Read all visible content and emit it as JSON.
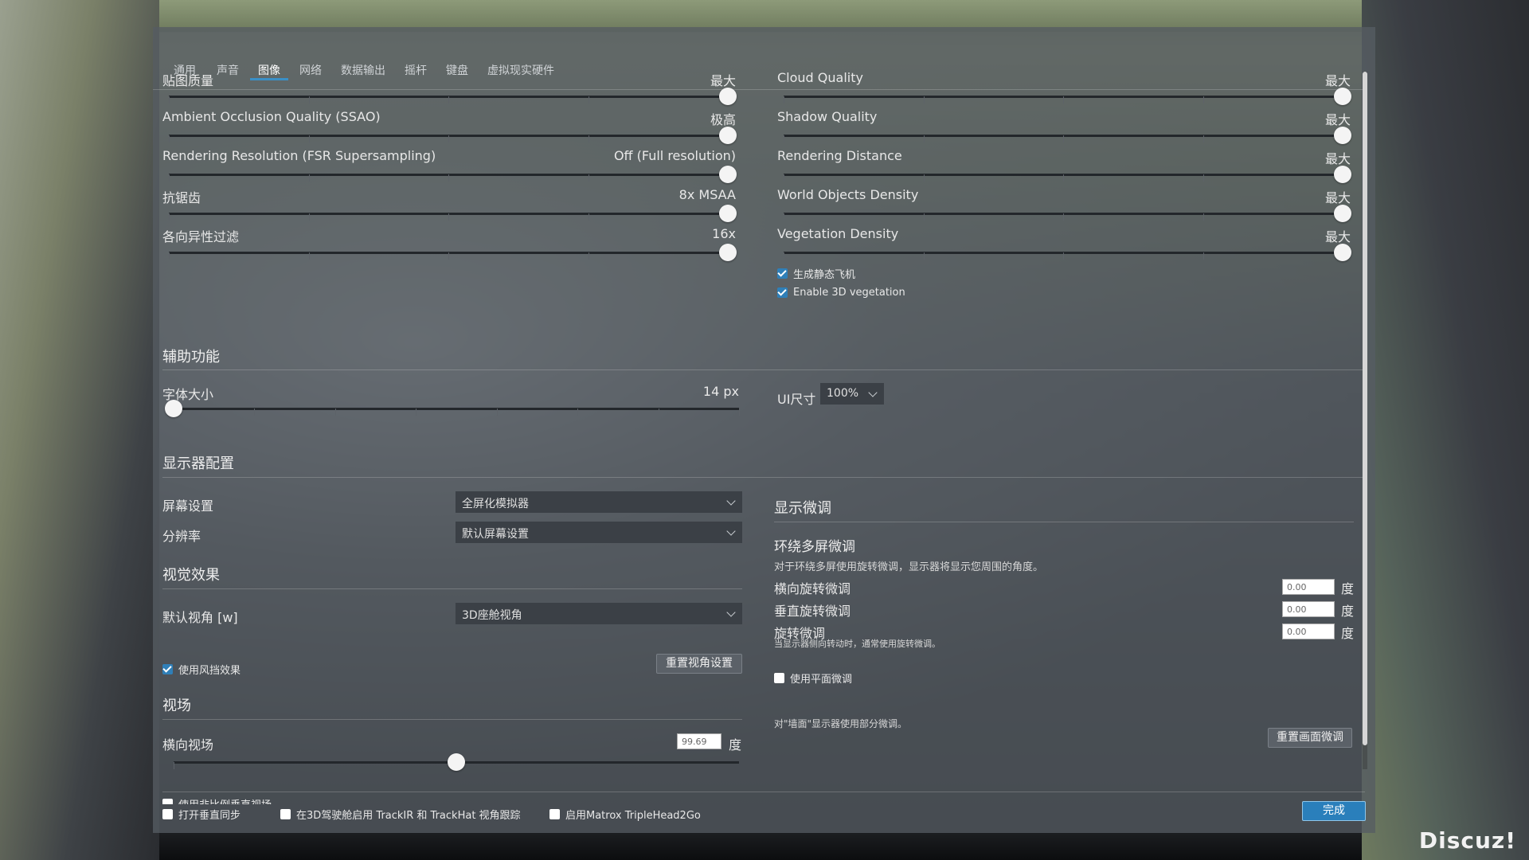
{
  "tabs": [
    "通用",
    "声音",
    "图像",
    "网络",
    "数据输出",
    "摇杆",
    "键盘",
    "虚拟现实硬件"
  ],
  "active_tab": "图像",
  "left_sliders": [
    {
      "label": "贴图质量",
      "value": "最大",
      "level": 1.0
    },
    {
      "label": "Ambient Occlusion Quality (SSAO)",
      "value": "极高",
      "level": 1.0
    },
    {
      "label": "Rendering Resolution (FSR Supersampling)",
      "value": "Off (Full resolution)",
      "level": 1.0
    },
    {
      "label": "抗锯齿",
      "value": "8x MSAA",
      "level": 1.0
    },
    {
      "label": "各向异性过滤",
      "value": "16x",
      "level": 1.0
    }
  ],
  "right_sliders": [
    {
      "label": "Cloud Quality",
      "value": "最大",
      "level": 1.0
    },
    {
      "label": "Shadow Quality",
      "value": "最大",
      "level": 1.0
    },
    {
      "label": "Rendering Distance",
      "value": "最大",
      "level": 1.0
    },
    {
      "label": "World Objects Density",
      "value": "最大",
      "level": 1.0
    },
    {
      "label": "Vegetation Density",
      "value": "最大",
      "level": 1.0
    }
  ],
  "right_checkboxes": [
    {
      "label": "生成静态飞机",
      "checked": true
    },
    {
      "label": "Enable 3D vegetation",
      "checked": true
    }
  ],
  "accessibility": {
    "title": "辅助功能",
    "font_size_label": "字体大小",
    "font_size_value": "14 px",
    "font_size_level": 0.0,
    "ui_size_label": "UI尺寸",
    "ui_size_value": "100%"
  },
  "monitor": {
    "title": "显示器配置",
    "screen_label": "屏幕设置",
    "screen_value": "全屏化模拟器",
    "resolution_label": "分辨率",
    "resolution_value": "默认屏幕设置",
    "visual_title": "视觉效果",
    "default_view_label": "默认视角 [w]",
    "default_view_value": "3D座舱视角",
    "windshield_label": "使用风挡效果",
    "windshield_checked": true,
    "reset_view_button": "重置视角设置",
    "fov_title": "视场",
    "h_fov_label": "横向视场",
    "h_fov_value": "99.69",
    "h_fov_unit": "度",
    "h_fov_level": 0.5,
    "cut_row_label": "使用非比例垂直视场"
  },
  "fine_tune": {
    "title": "显示微调",
    "surround_title": "环绕多屏微调",
    "surround_desc": "对于环绕多屏使用旋转微调，显示器将显示您周围的角度。",
    "lateral_label": "横向旋转微调",
    "lateral_value": "0.00",
    "vertical_label": "垂直旋转微调",
    "vertical_value": "0.00",
    "roll_label": "旋转微调",
    "roll_value": "0.00",
    "roll_desc": "当显示器侧向转动时，通常使用旋转微调。",
    "unit": "度",
    "flat_label": "使用平面微调",
    "flat_desc": "对\"墙面\"显示器使用部分微调。",
    "reset_button": "重置画面微调"
  },
  "footer": {
    "vsync_label": "打开垂直同步",
    "trackir_label": "在3D驾驶舱启用 TrackIR 和 TrackHat 视角跟踪",
    "matrox_label": "启用Matrox TripleHead2Go",
    "done_button": "完成"
  },
  "watermark": "Discuz!"
}
